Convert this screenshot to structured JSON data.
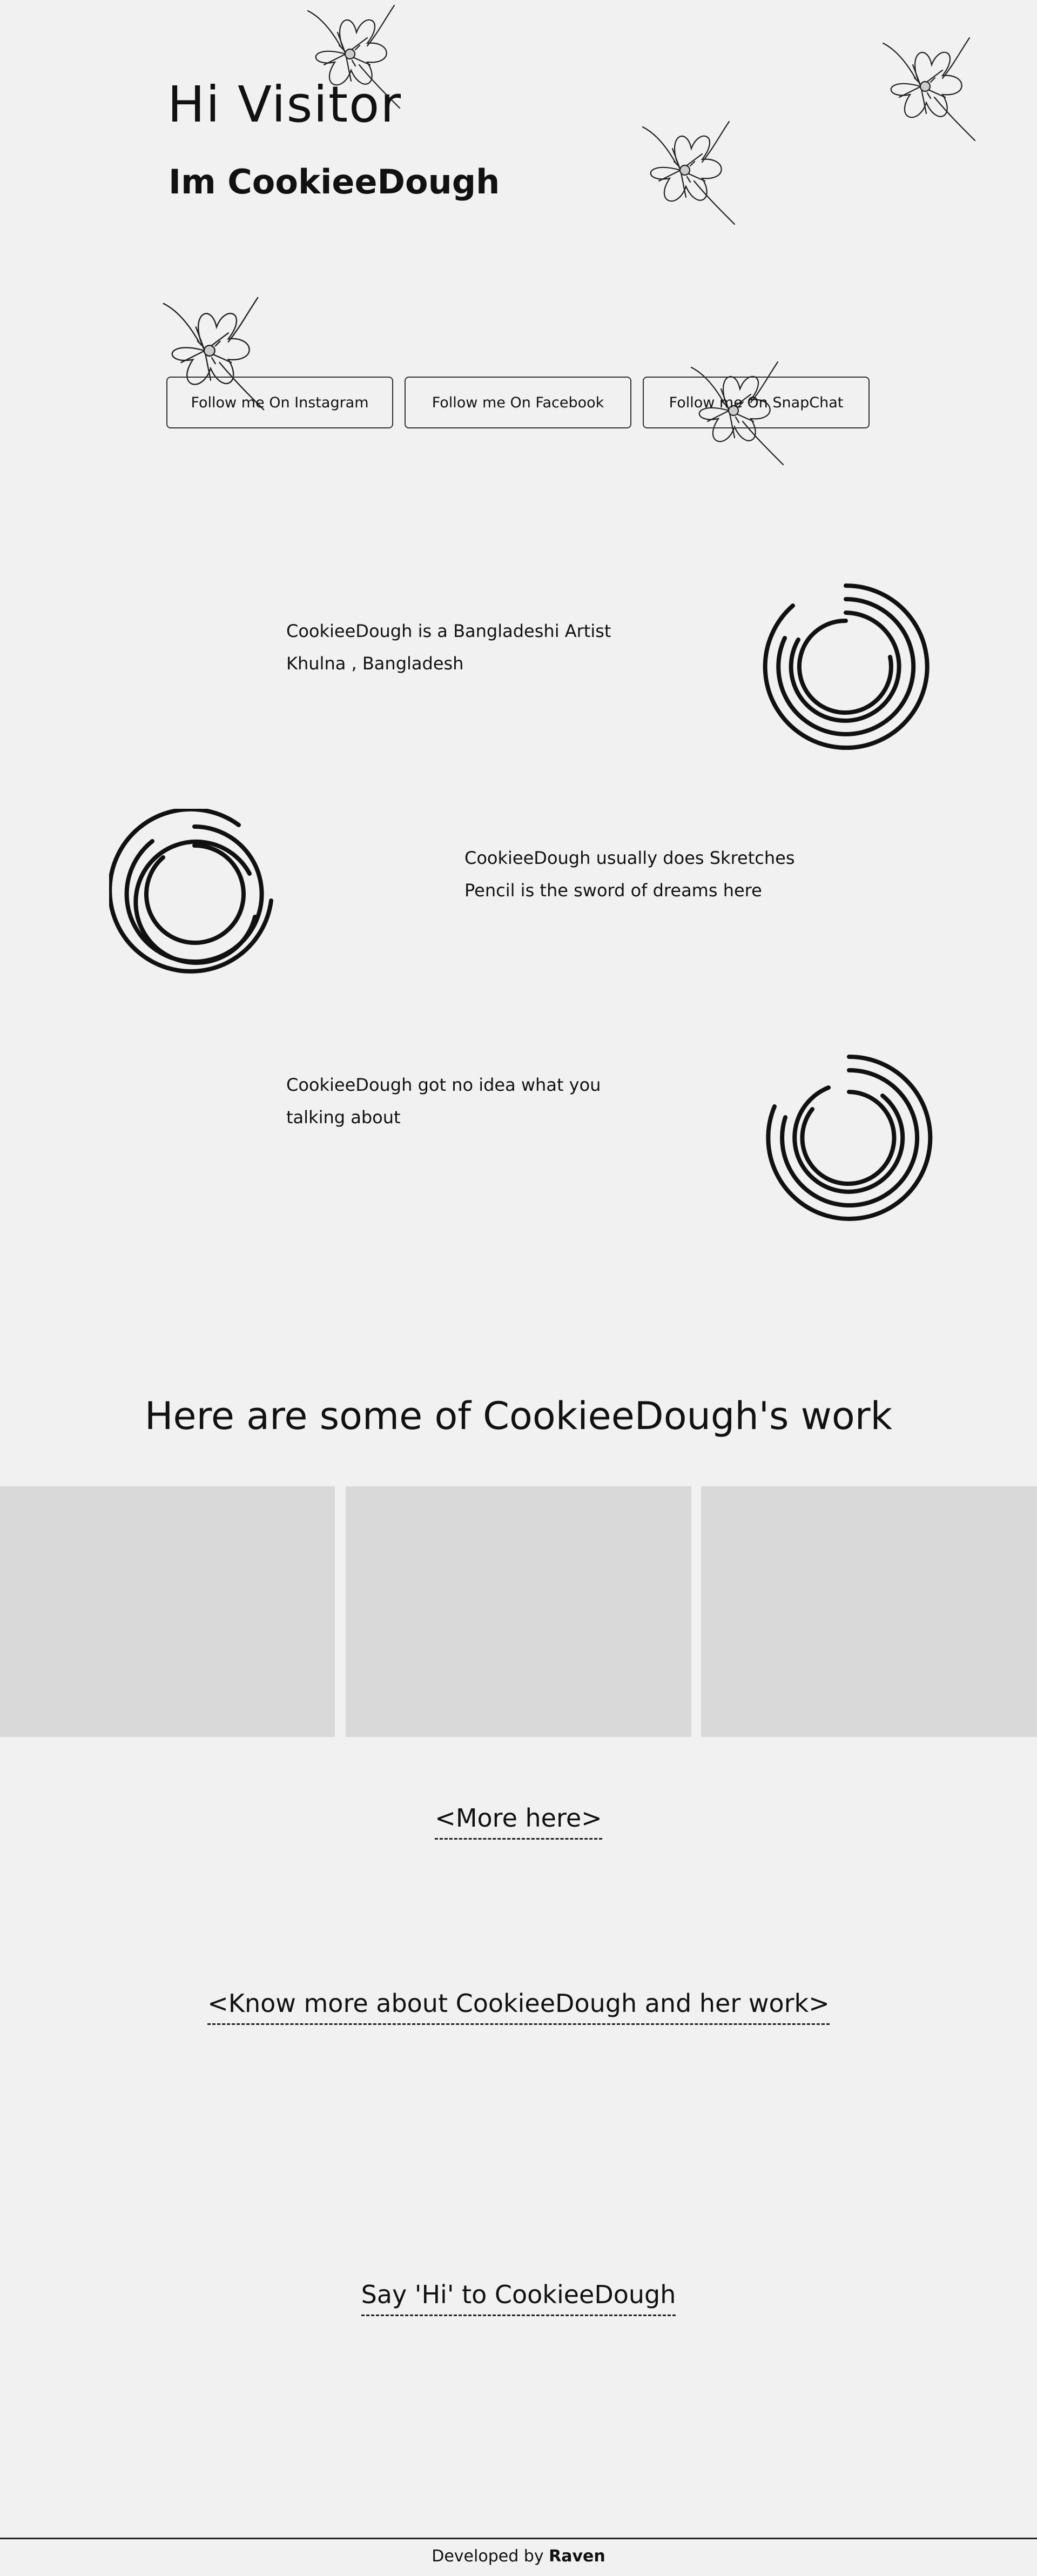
{
  "hero": {
    "greeting": "Hi Visitor",
    "intro": "Im CookieeDough"
  },
  "social": {
    "instagram": "Follow me On Instagram",
    "facebook": "Follow me On Facebook",
    "snapchat": "Follow me On SnapChat"
  },
  "about": [
    {
      "line1": "CookieeDough is a Bangladeshi Artist",
      "line2": "Khulna , Bangladesh"
    },
    {
      "line1": "CookieeDough usually does Skretches",
      "line2": "Pencil is the sword of dreams here"
    },
    {
      "line1": "CookieeDough got no idea what you",
      "line2": "talking about"
    }
  ],
  "work": {
    "title": "Here are some of CookieeDough's work",
    "more_link": "<More here>"
  },
  "know_more_link": "<Know more about CookieeDough and her work>",
  "say_hi_link": "Say 'Hi' to CookieeDough",
  "footer": {
    "prefix": "Developed by",
    "developer": "Raven"
  },
  "colors": {
    "background": "#f1f1f1",
    "ink": "#111111",
    "gallery_tile": "#d9d9d9"
  }
}
